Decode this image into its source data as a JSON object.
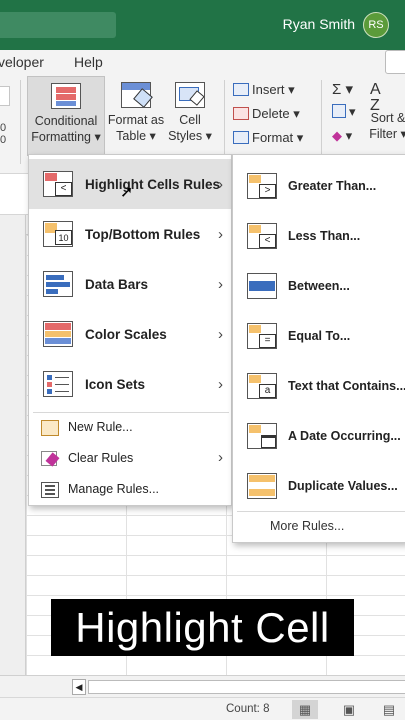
{
  "titlebar": {
    "user_name": "Ryan Smith",
    "avatar_initials": "RS",
    "accent": "#217346"
  },
  "tabs": [
    "veloper",
    "Help"
  ],
  "ribbon": {
    "num_fragment": "0\n0",
    "conditional_formatting": {
      "line1": "Conditional",
      "line2": "Formatting ▾"
    },
    "format_as_table": {
      "line1": "Format as",
      "line2": "Table ▾"
    },
    "cell_styles": {
      "line1": "Cell",
      "line2": "Styles ▾"
    },
    "insert": "Insert ▾",
    "delete": "Delete ▾",
    "format": "Format ▾",
    "sum_symbol": "Σ ▾",
    "sort_filter": {
      "line1": "Sort &",
      "line2": "Filter ▾"
    }
  },
  "menu": {
    "items": [
      {
        "label": "Highlight Cells Rules",
        "icon": "highlight-cells-icon"
      },
      {
        "label": "Top/Bottom Rules",
        "icon": "top-bottom-icon"
      },
      {
        "label": "Data Bars",
        "icon": "data-bars-icon"
      },
      {
        "label": "Color Scales",
        "icon": "color-scales-icon"
      },
      {
        "label": "Icon Sets",
        "icon": "icon-sets-icon"
      }
    ],
    "small_items": [
      {
        "label": "New Rule..."
      },
      {
        "label": "Clear Rules"
      },
      {
        "label": "Manage Rules..."
      }
    ]
  },
  "submenu": {
    "items": [
      {
        "label": "Greater Than..."
      },
      {
        "label": "Less Than..."
      },
      {
        "label": "Between..."
      },
      {
        "label": "Equal To..."
      },
      {
        "label": "Text that Contains..."
      },
      {
        "label": "A Date Occurring..."
      },
      {
        "label": "Duplicate Values..."
      }
    ],
    "more_rules": "More Rules..."
  },
  "caption": "Highlight Cell",
  "statusbar": {
    "count": "Count: 8"
  }
}
